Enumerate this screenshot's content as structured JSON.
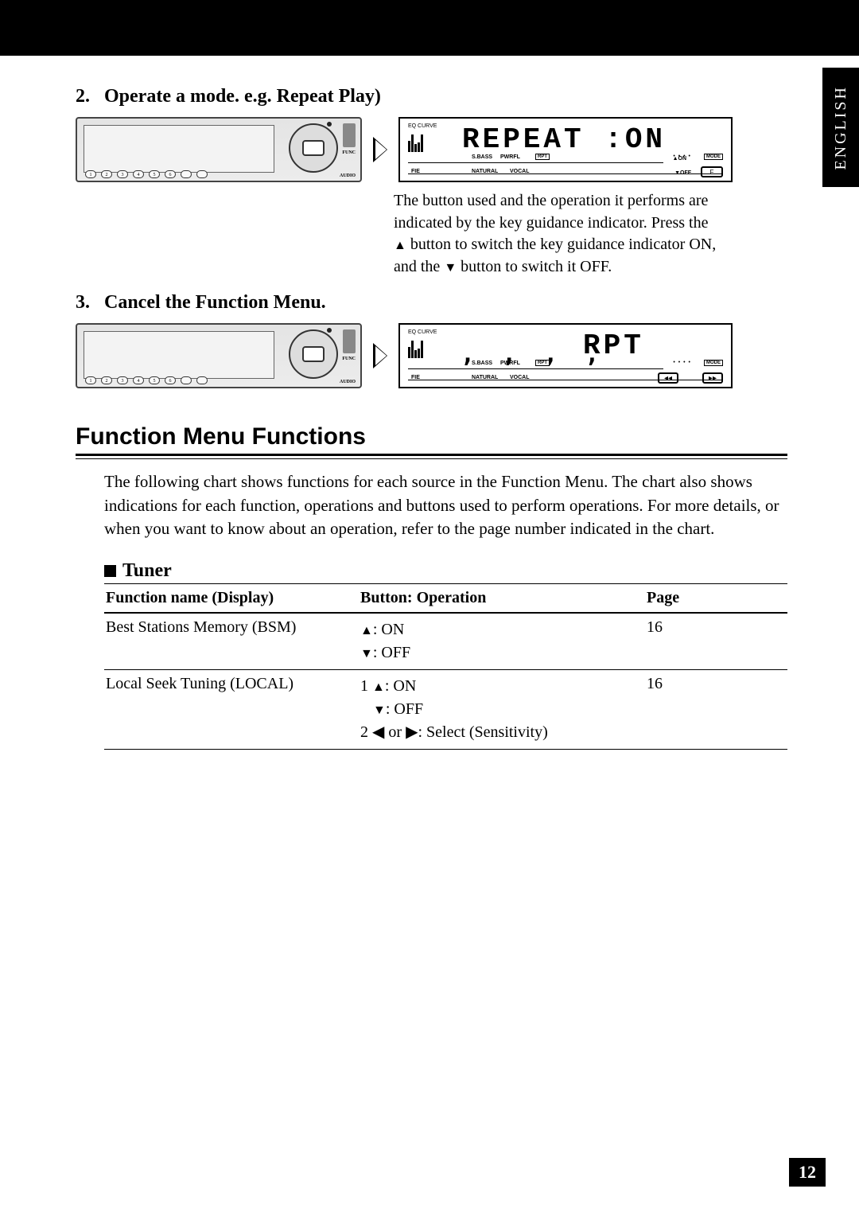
{
  "side_tab": "ENGLISH",
  "steps": {
    "s2": {
      "num": "2.",
      "title": "Operate a mode. e.g. Repeat Play)"
    },
    "s3": {
      "num": "3.",
      "title": "Cancel the Function Menu."
    }
  },
  "lcd1": {
    "eq": "EQ CURVE",
    "text": "REPEAT :ON",
    "sbass": "S.BASS",
    "pwrfl": "PWRFL",
    "rpt": "RPT",
    "dots": "• • • •",
    "mode": "MODE",
    "fie": "FIE",
    "natural": "NATURAL",
    "vocal": "VOCAL",
    "f_btn": "F",
    "on": "ON",
    "off": "OFF"
  },
  "lcd2": {
    "eq": "EQ CURVE",
    "rpt_big": "RPT",
    "sbass": "S.BASS",
    "pwrfl": "PWRFL",
    "rpt": "RPT",
    "dots": "• • • •",
    "mode": "MODE",
    "fie": "FIE",
    "natural": "NATURAL",
    "vocal": "VOCAL",
    "seek_l": "◂◂",
    "seek_r": "▸▸"
  },
  "desc_lines": {
    "l1": "The button used and the operation it performs are",
    "l2": "indicated by the key guidance indicator. Press the",
    "l3a_pre": "",
    "l3a_post": " button to switch the key guidance indicator ON,",
    "l4_pre": "and the ",
    "l4_post": " button to switch it OFF."
  },
  "big_section": "Function Menu Functions",
  "para": "The following chart shows functions for each source in the Function Menu. The chart also shows indications for each function, operations and buttons used to perform operations. For more details, or when you want to know about an operation, refer to the page number indicated in the chart.",
  "sub_tuner": "Tuner",
  "table": {
    "h1": "Function name (Display)",
    "h2": "Button: Operation",
    "h3": "Page",
    "r1": {
      "name": "Best Stations Memory (BSM)",
      "ops": {
        "a": ": ON",
        "b": ": OFF"
      },
      "page": "16"
    },
    "r2": {
      "name": "Local Seek Tuning (LOCAL)",
      "ops": {
        "a_pre": "1 ",
        "a_post": ": ON",
        "b": ": OFF",
        "c_pre": "2 ",
        "c_mid": " or ",
        "c_post": ": Select (Sensitivity)"
      },
      "page": "16"
    }
  },
  "symbols": {
    "up": "▲",
    "down": "▼",
    "left": "◀",
    "right": "▶"
  },
  "page_number": "12"
}
